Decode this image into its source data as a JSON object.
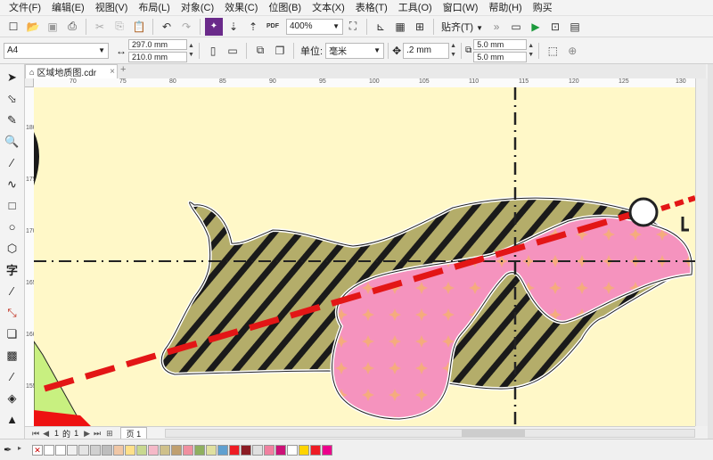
{
  "menu": [
    "文件(F)",
    "编辑(E)",
    "视图(V)",
    "布局(L)",
    "对象(C)",
    "效果(C)",
    "位图(B)",
    "文本(X)",
    "表格(T)",
    "工具(O)",
    "窗口(W)",
    "帮助(H)",
    "购买"
  ],
  "toolbar": {
    "zoom_value": "400%",
    "pdf_label": "PDF",
    "snap_label": "贴齐(T)"
  },
  "propbar": {
    "paper_size": "A4",
    "width": "297.0 mm",
    "height": "210.0 mm",
    "unit_label": "单位:",
    "unit_value": "毫米",
    "nudge": ".2 mm",
    "dup_x": "5.0 mm",
    "dup_y": "5.0 mm"
  },
  "document_tab": "区域地质图.cdr",
  "rulers": {
    "h_labels": [
      "70",
      "75",
      "80",
      "85",
      "90",
      "95",
      "100",
      "105",
      "110",
      "115",
      "120",
      "125",
      "130"
    ],
    "v_labels": [
      "180",
      "175",
      "170",
      "165",
      "160",
      "155"
    ]
  },
  "page_nav": {
    "current": "1",
    "of_label": "的",
    "total": "1",
    "page_tab": "页 1"
  },
  "palette": [
    "#ffffff",
    "#ffffff",
    "#f0f0f0",
    "#e4e4e4",
    "#d0d0d0",
    "#bdbdbd",
    "#f0c7a6",
    "#ffe08a",
    "#c8d890",
    "#f5b9c8",
    "#cfc08a",
    "#c0a070",
    "#f090a0",
    "#8fb060",
    "#e0e0a0",
    "#60a0d0",
    "#ee1c24",
    "#8c1c24",
    "#e0e0e0",
    "#f080a0",
    "#cc1177",
    "#ffffff",
    "#ffd400",
    "#ee1c24",
    "#ec008c"
  ],
  "colors": {
    "canvas_bg": "#fff8c8",
    "hatch_fill": "#b4ad6a",
    "pink_fill": "#f593be",
    "red_line": "#e31616"
  }
}
